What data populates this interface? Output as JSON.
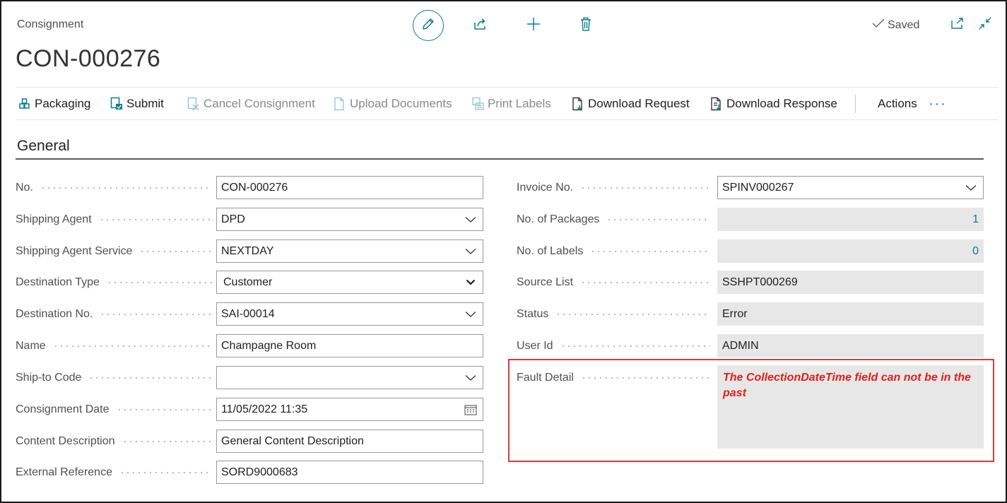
{
  "header": {
    "caption": "Consignment",
    "title": "CON-000276",
    "status": "Saved"
  },
  "top_icons": [
    "pencil-icon",
    "share-icon",
    "plus-icon",
    "trash-icon"
  ],
  "window_icons": [
    "open-new-window-icon",
    "collapse-icon"
  ],
  "actions": {
    "packaging": "Packaging",
    "submit": "Submit",
    "cancel_consignment": "Cancel Consignment",
    "upload_documents": "Upload Documents",
    "print_labels": "Print Labels",
    "download_request": "Download Request",
    "download_response": "Download Response",
    "actions": "Actions",
    "more": "···"
  },
  "section": {
    "title": "General"
  },
  "left_fields": {
    "no": {
      "label": "No.",
      "value": "CON-000276"
    },
    "shipping_agent": {
      "label": "Shipping Agent",
      "value": "DPD"
    },
    "shipping_agent_service": {
      "label": "Shipping Agent Service",
      "value": "NEXTDAY"
    },
    "destination_type": {
      "label": "Destination Type",
      "value": "Customer"
    },
    "destination_no": {
      "label": "Destination No.",
      "value": "SAI-00014"
    },
    "name": {
      "label": "Name",
      "value": "Champagne Room"
    },
    "ship_to_code": {
      "label": "Ship-to Code",
      "value": ""
    },
    "consignment_date": {
      "label": "Consignment Date",
      "value": "11/05/2022 11:35"
    },
    "content_description": {
      "label": "Content Description",
      "value": "General Content Description"
    },
    "external_reference": {
      "label": "External Reference",
      "value": "SORD9000683"
    }
  },
  "right_fields": {
    "invoice_no": {
      "label": "Invoice No.",
      "value": "SPINV000267"
    },
    "no_of_packages": {
      "label": "No. of Packages",
      "value": "1"
    },
    "no_of_labels": {
      "label": "No. of Labels",
      "value": "0"
    },
    "source_list": {
      "label": "Source List",
      "value": "SSHPT000269"
    },
    "status": {
      "label": "Status",
      "value": "Error"
    },
    "user_id": {
      "label": "User Id",
      "value": "ADMIN"
    },
    "fault_detail": {
      "label": "Fault Detail",
      "value": "The CollectionDateTime field can not be in the past"
    }
  },
  "colors": {
    "accent": "#0a7e8c",
    "error_text": "#e0201c",
    "highlight_border": "#e03a3a"
  }
}
